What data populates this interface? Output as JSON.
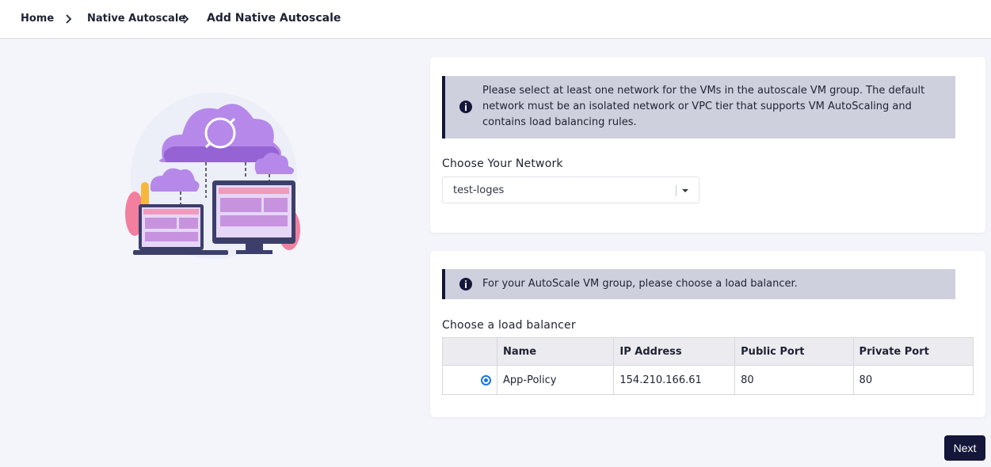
{
  "breadcrumb": {
    "home": "Home",
    "parent": "Native Autoscale",
    "current": "Add Native Autoscale"
  },
  "illustration": {
    "icon": "cloud-sync-illustration"
  },
  "network_card": {
    "info_icon": "info-icon",
    "info_text": "Please select at least one network for the VMs in the autoscale VM group. The default network must be an isolated network or VPC tier that supports VM AutoScaling and contains load balancing rules.",
    "label": "Choose Your Network",
    "selected_network": "test-loges"
  },
  "lb_card": {
    "info_icon": "info-icon",
    "info_text": "For your AutoScale VM group, please choose a load balancer.",
    "label": "Choose a load balancer",
    "columns": [
      "",
      "Name",
      "IP Address",
      "Public Port",
      "Private Port"
    ],
    "rows": [
      {
        "selected": true,
        "name": "App-Policy",
        "ip": "154.210.166.61",
        "public_port": "80",
        "private_port": "80"
      }
    ]
  },
  "actions": {
    "next_label": "Next"
  },
  "colors": {
    "accent": "#14163a",
    "alert_bg": "#cfd0dd",
    "page_bg": "#f4f5fb"
  }
}
